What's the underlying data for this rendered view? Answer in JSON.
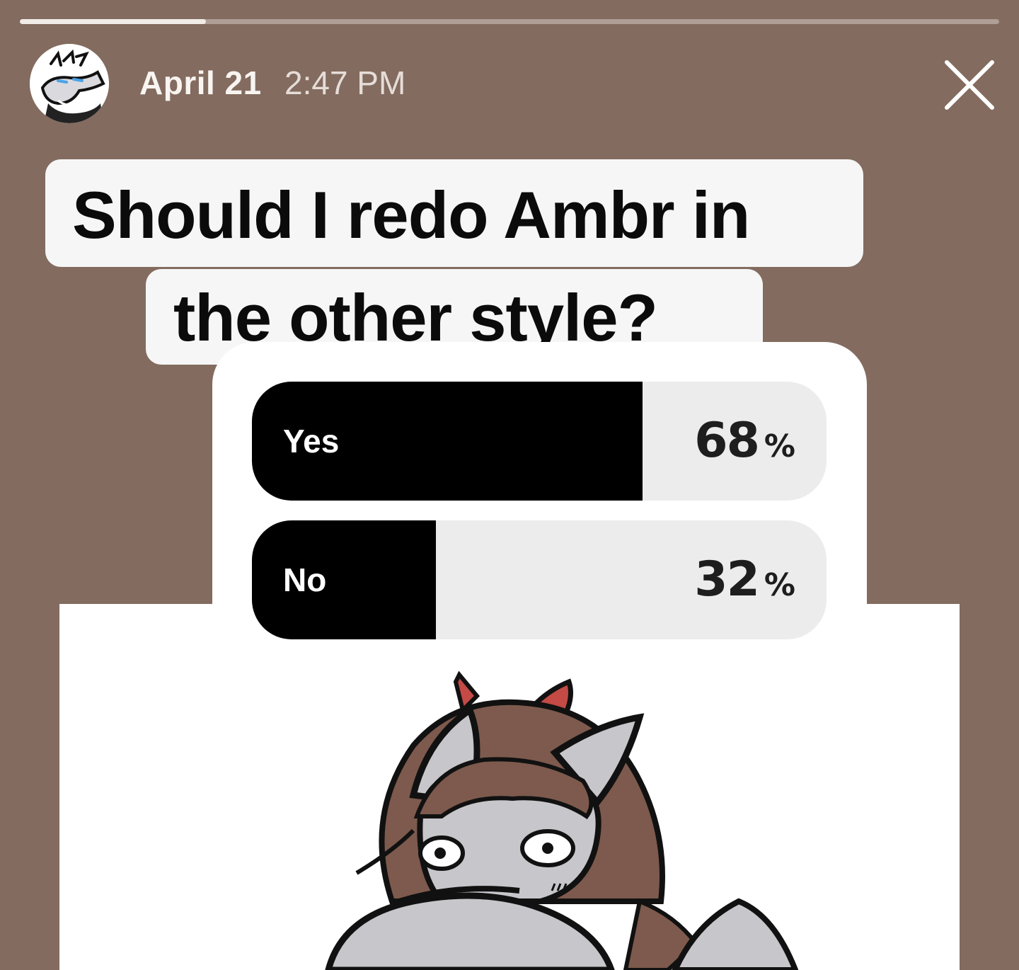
{
  "story": {
    "progress": 0.19,
    "date": "April 21",
    "time": "2:47 PM"
  },
  "poll": {
    "question_line1": "Should I redo Ambr in",
    "question_line2": "the other style?",
    "options": [
      {
        "label": "Yes",
        "percent": "68",
        "percent_sign": "%",
        "share": 0.68
      },
      {
        "label": "No",
        "percent": "32",
        "percent_sign": "%",
        "share": 0.32
      }
    ]
  },
  "icons": {
    "close": "close-icon",
    "avatar": "profile-avatar-drawing"
  },
  "colors": {
    "background": "#836b5f",
    "poll_fill": "#000000",
    "poll_track": "#ececec",
    "ribbon": "#c34a45",
    "hair": "#7d5a4d",
    "skin_gray": "#c6c6cb"
  }
}
